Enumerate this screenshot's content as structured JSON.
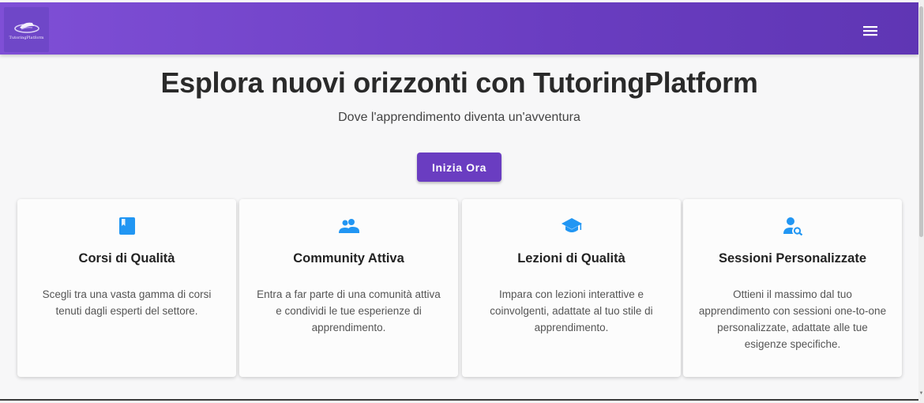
{
  "header": {
    "logo_text": "TutoringPlatform",
    "menu_icon": "hamburger-menu-icon"
  },
  "hero": {
    "title": "Esplora nuovi orizzonti con TutoringPlatform",
    "subtitle": "Dove l'apprendimento diventa un'avventura",
    "cta_label": "Inizia Ora"
  },
  "colors": {
    "header_gradient": [
      "#7f4fd6",
      "#5f36b4"
    ],
    "primary_button": "#6a3dc1",
    "icon_accent": "#2196f3"
  },
  "features": [
    {
      "icon": "book-icon",
      "title": "Corsi di Qualità",
      "text": "Scegli tra una vasta gamma di corsi tenuti dagli esperti del settore."
    },
    {
      "icon": "people-icon",
      "title": "Community Attiva",
      "text": "Entra a far parte di una comunità attiva e condividi le tue esperienze di apprendimento."
    },
    {
      "icon": "graduation-cap-icon",
      "title": "Lezioni di Qualità",
      "text": "Impara con lezioni interattive e coinvolgenti, adattate al tuo stile di apprendimento."
    },
    {
      "icon": "person-search-icon",
      "title": "Sessioni Personalizzate",
      "text": "Ottieni il massimo dal tuo apprendimento con sessioni one-to-one personalizzate, adattate alle tue esigenze specifiche."
    }
  ]
}
